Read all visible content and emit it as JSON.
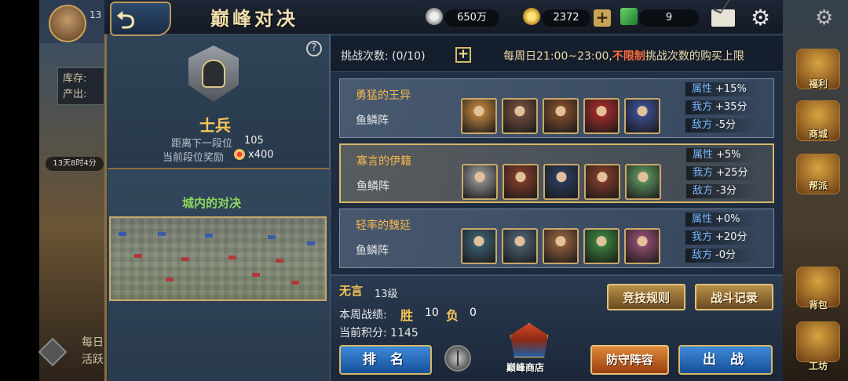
{
  "header": {
    "title": "巅峰对决",
    "silver": "650万",
    "gold": "2372",
    "tickets": "9"
  },
  "underlay": {
    "level": "13",
    "storage_label": "库存:",
    "output_label": "产出:",
    "timer": "13天8时4分",
    "bottom_line1": "每日",
    "bottom_line2": "活跃",
    "side_labels": [
      "福利",
      "商城",
      "帮派",
      "背包",
      "工坊"
    ]
  },
  "rank": {
    "name": "士兵",
    "distance_label": "距离下一段位",
    "distance_value": "105",
    "reward_label": "当前段位奖励",
    "reward_value": "x400"
  },
  "map": {
    "title": "城内的对决"
  },
  "challenge": {
    "label": "挑战次数: (0/10)",
    "note_prefix": "每周日21:00~23:00,",
    "note_highlight": "不限制",
    "note_suffix": "挑战次数的购买上限"
  },
  "opponents": [
    {
      "name": "勇猛的王异",
      "formation": "鱼鳞阵",
      "attr": "+15%",
      "ours": "+35分",
      "theirs": "-5分",
      "selected": false,
      "hero_colors": [
        "#b07a3a",
        "#6a4a3a",
        "#7a4a2a",
        "#9a2a2a",
        "#3a4a8a"
      ]
    },
    {
      "name": "寡言的伊籍",
      "formation": "鱼鳞阵",
      "attr": "+5%",
      "ours": "+25分",
      "theirs": "-3分",
      "selected": true,
      "hero_colors": [
        "#8a8a8a",
        "#7a3a2a",
        "#2a3a5a",
        "#7a3a2a",
        "#5a8a5a"
      ]
    },
    {
      "name": "轻率的魏延",
      "formation": "鱼鳞阵",
      "attr": "+0%",
      "ours": "+20分",
      "theirs": "-0分",
      "selected": false,
      "hero_colors": [
        "#3a5a6a",
        "#4a5a6a",
        "#8a5a3a",
        "#3a7a3a",
        "#8a4a6a"
      ]
    }
  ],
  "labels": {
    "attr": "属性",
    "ours": "我方",
    "theirs": "敌方"
  },
  "player": {
    "name": "无言",
    "level": "13级",
    "week_label": "本周战绩:",
    "win_label": "胜",
    "win_value": "10",
    "loss_label": "负",
    "loss_value": "0",
    "score": "当前积分: 1145"
  },
  "buttons": {
    "rules": "竞技规则",
    "records": "战斗记录",
    "ranking": "排 名",
    "shop": "巅峰商店",
    "defense": "防守阵容",
    "fight": "出 战"
  }
}
